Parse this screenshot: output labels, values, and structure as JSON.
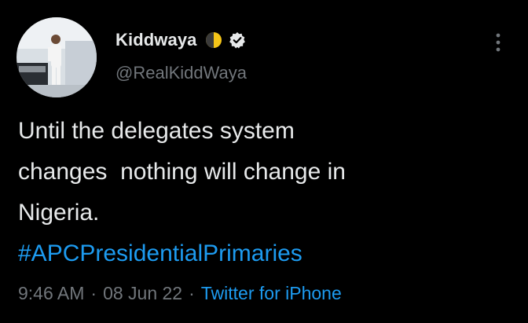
{
  "author": {
    "display_name": "Kiddwaya",
    "handle": "@RealKiddWaya",
    "emoji_icon": "moon-icon",
    "verified": true
  },
  "tweet": {
    "text": "Until the delegates system\nchanges  nothing will change in\nNigeria.",
    "hashtag": "#APCPresidentialPrimaries"
  },
  "meta": {
    "time": "9:46 AM",
    "separator": "·",
    "date": "08 Jun 22",
    "source": "Twitter for iPhone"
  },
  "colors": {
    "background": "#000000",
    "primary_text": "#e7e9ea",
    "secondary_text": "#71767b",
    "link": "#1d9bf0"
  }
}
